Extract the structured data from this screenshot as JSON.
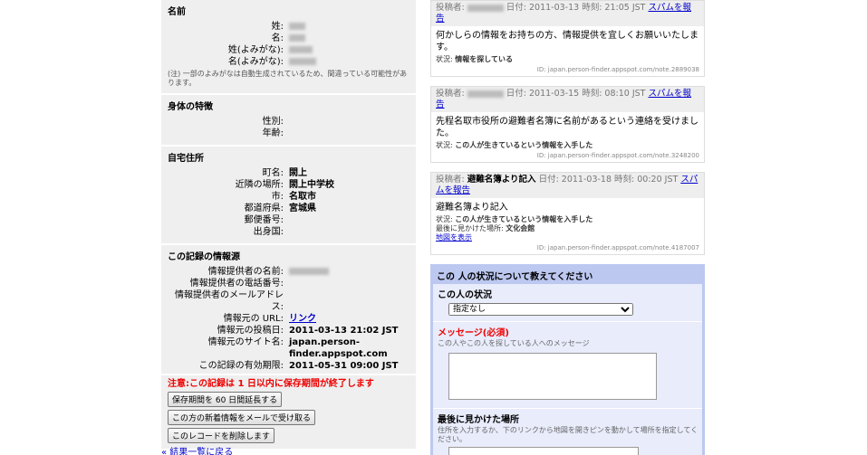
{
  "name_section": {
    "title": "名前",
    "rows": [
      {
        "label": "姓:"
      },
      {
        "label": "名:"
      },
      {
        "label": "姓(よみがな):"
      },
      {
        "label": "名(よみがな):"
      }
    ],
    "note": "(注) 一部のよみがなは自動生成されているため、間違っている可能性があります。"
  },
  "physical_section": {
    "title": "身体の特徴",
    "rows": [
      {
        "label": "性別:",
        "value": ""
      },
      {
        "label": "年齢:",
        "value": ""
      }
    ]
  },
  "address_section": {
    "title": "自宅住所",
    "rows": [
      {
        "label": "町名:",
        "value": "閖上"
      },
      {
        "label": "近隣の場所:",
        "value": "閖上中学校"
      },
      {
        "label": "市:",
        "value": "名取市"
      },
      {
        "label": "都道府県:",
        "value": "宮城県"
      },
      {
        "label": "郵便番号:",
        "value": ""
      },
      {
        "label": "出身国:",
        "value": ""
      }
    ]
  },
  "source_section": {
    "title": "この記録の情報源",
    "rows": [
      {
        "label": "情報提供者の名前:",
        "value": ""
      },
      {
        "label": "情報提供者の電話番号:",
        "value": ""
      },
      {
        "label": "情報提供者のメールアドレス:",
        "value": ""
      },
      {
        "label": "情報元の URL:",
        "value": "リンク"
      },
      {
        "label": "情報元の投稿日:",
        "value": "2011-03-13 21:02 JST"
      },
      {
        "label": "情報元のサイト名:",
        "value": "japan.person-finder.appspot.com"
      },
      {
        "label": "この記録の有効期限:",
        "value": "2011-05-31 09:00 JST"
      }
    ],
    "warning": "注意:この記録は 1 日以内に保存期間が終了します",
    "buttons": [
      "保存期間を 60 日間延長する",
      "この方の新着情報をメールで受け取る",
      "このレコードを削除します"
    ]
  },
  "back_link": "« 結果一覧に戻る",
  "notes": [
    {
      "head_prefix": "投稿者:",
      "author": "",
      "date": "日付: 2011-03-13 時刻: 21:05 JST",
      "spam": "スパムを報告",
      "body": "何かしらの情報をお持ちの方、情報提供を宜しくお願いいたします。",
      "status_label": "状況: ",
      "status": "情報を探している",
      "last_seen": "",
      "map_link": "",
      "id": "ID: japan.person-finder.appspot.com/note.2889038"
    },
    {
      "head_prefix": "投稿者:",
      "author": "",
      "date": "日付: 2011-03-15 時刻: 08:10 JST",
      "spam": "スパムを報告",
      "body": "先程名取市役所の避難者名簿に名前があるという連絡を受けました。",
      "status_label": "状況: ",
      "status": "この人が生きているという情報を入手した",
      "last_seen": "",
      "map_link": "",
      "id": "ID: japan.person-finder.appspot.com/note.3248200"
    },
    {
      "head_prefix": "投稿者:",
      "author": "避難名簿より記入",
      "date": "日付: 2011-03-18 時刻: 00:20 JST",
      "spam": "スパムを報告",
      "body": "避難名簿より記入",
      "status_label": "状況: ",
      "status": "この人が生きているという情報を入手した",
      "last_seen_label": "最後に見かけた場所: ",
      "last_seen": "文化会館",
      "map_link": "地図を表示",
      "id": "ID: japan.person-finder.appspot.com/note.4187007"
    }
  ],
  "form": {
    "title": "この 人の状況について教えてください",
    "status_label": "この人の状況",
    "status_selected": "指定なし",
    "message_label": "メッセージ(必須)",
    "message_hint": "この人やこの人を探している人へのメッセージ",
    "last_seen_label": "最後に見かけた場所",
    "last_seen_hint": "住所を入力するか、下のリンクから地図を開きピンを動かして場所を指定してください。"
  },
  "colors": {
    "link": "#0000cc",
    "warning": "#ee0000",
    "section_bg": "#efefef",
    "form_border": "#bcc8f0"
  }
}
